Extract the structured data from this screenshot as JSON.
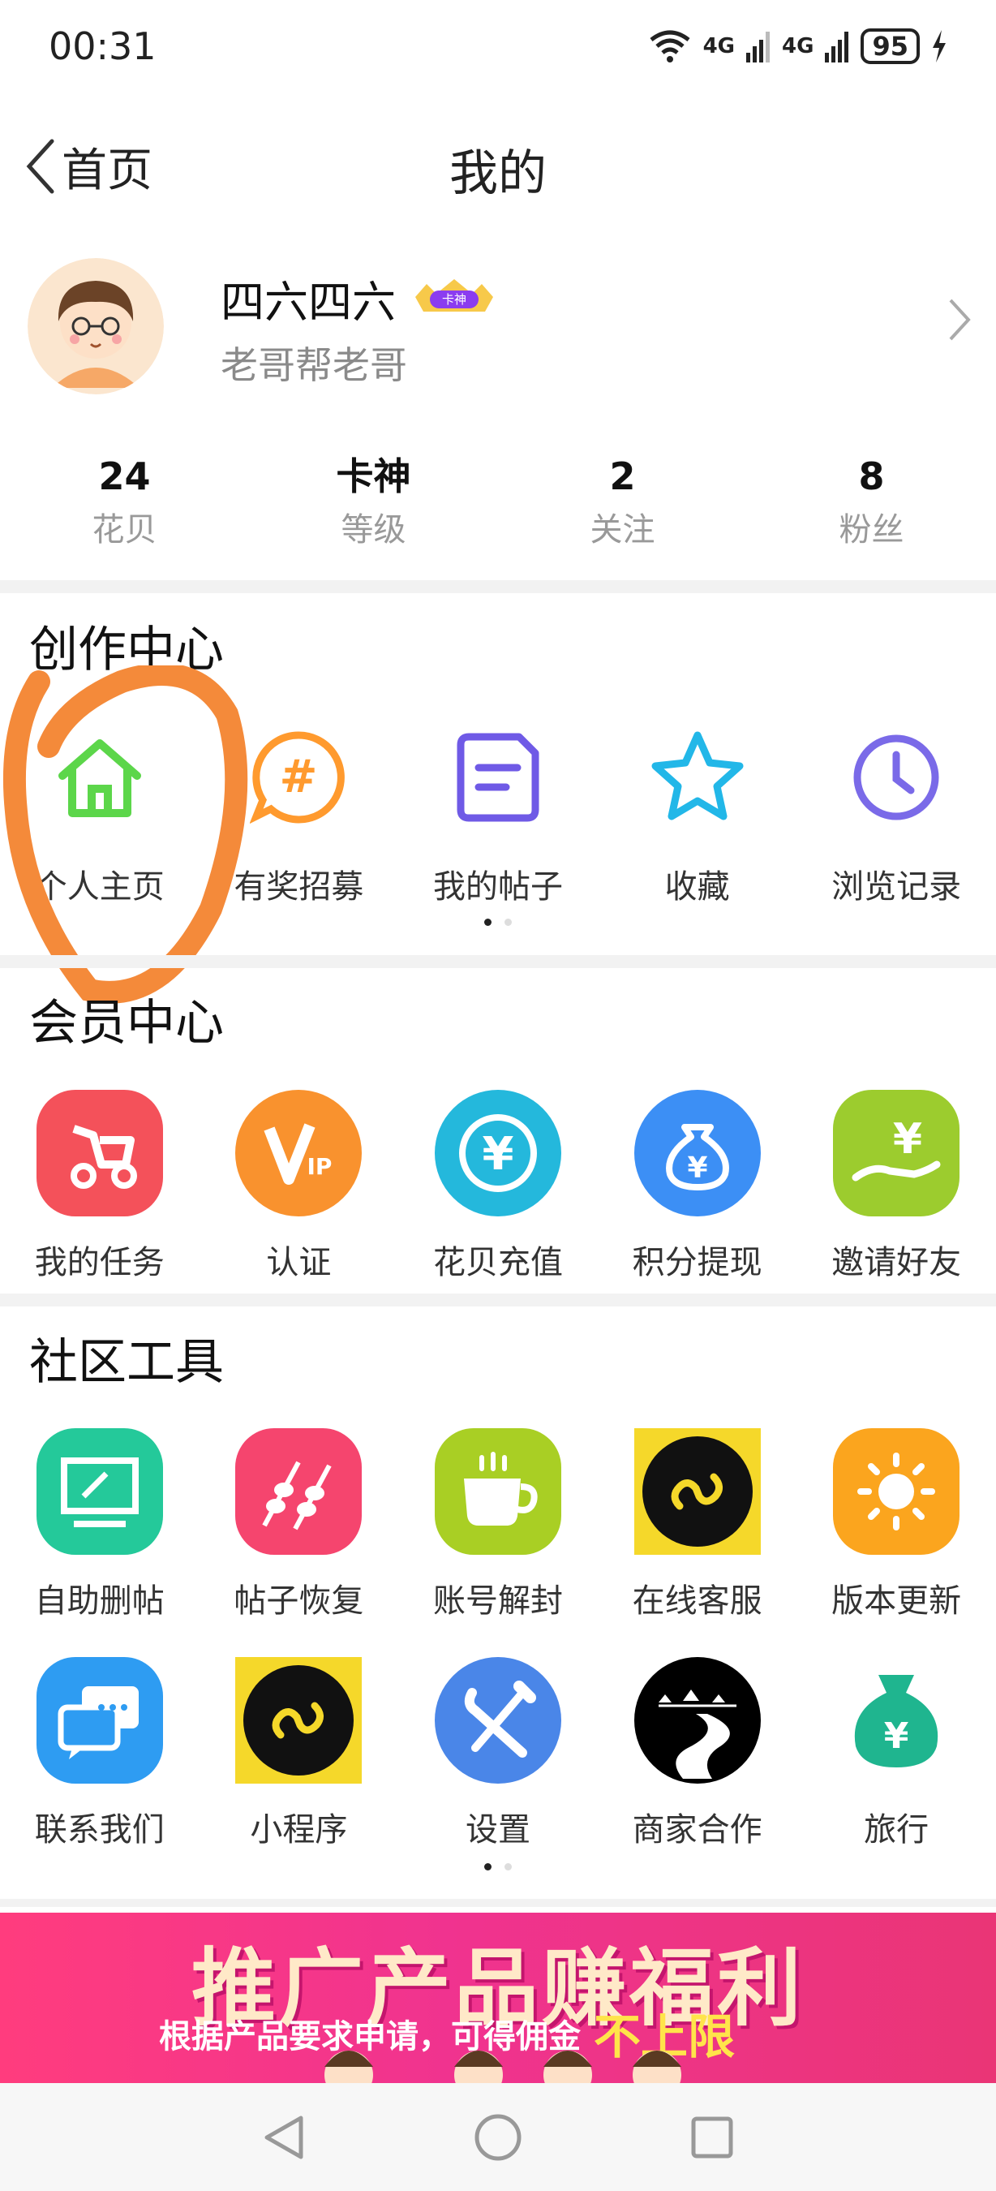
{
  "status_bar": {
    "time": "00:31",
    "battery": "95",
    "net1": "4G",
    "net2": "4G"
  },
  "header": {
    "back_label": "首页",
    "title": "我的"
  },
  "profile": {
    "nickname": "四六四六",
    "badge": "卡神",
    "signature": "老哥帮老哥"
  },
  "stats": [
    {
      "value": "24",
      "label": "花贝"
    },
    {
      "value": "卡神",
      "label": "等级"
    },
    {
      "value": "2",
      "label": "关注"
    },
    {
      "value": "8",
      "label": "粉丝"
    }
  ],
  "creation": {
    "title": "创作中心",
    "items": [
      {
        "label": "个人主页",
        "icon": "home-icon"
      },
      {
        "label": "有奖招募",
        "icon": "hashtag-icon"
      },
      {
        "label": "我的帖子",
        "icon": "document-icon"
      },
      {
        "label": "收藏",
        "icon": "star-icon"
      },
      {
        "label": "浏览记录",
        "icon": "clock-icon"
      }
    ]
  },
  "member": {
    "title": "会员中心",
    "items": [
      {
        "label": "我的任务",
        "icon": "scooter-icon",
        "color": "#f4515a"
      },
      {
        "label": "认证",
        "icon": "vip-icon",
        "color": "#f9922e"
      },
      {
        "label": "花贝充值",
        "icon": "coin-recharge-icon",
        "color": "#24b8dc"
      },
      {
        "label": "积分提现",
        "icon": "money-bag-icon",
        "color": "#3c8ff5"
      },
      {
        "label": "邀请好友",
        "icon": "hand-yuan-icon",
        "color": "#9ccc2e"
      }
    ]
  },
  "tools": {
    "title": "社区工具",
    "row1": [
      {
        "label": "自助删帖",
        "icon": "monitor-edit-icon",
        "color": "#24c99a"
      },
      {
        "label": "帖子恢复",
        "icon": "skewer-icon",
        "color": "#f5456e"
      },
      {
        "label": "账号解封",
        "icon": "coffee-cup-icon",
        "color": "#a9cf24"
      },
      {
        "label": "在线客服",
        "icon": "mini-program-icon",
        "color": "#f5d82a"
      },
      {
        "label": "版本更新",
        "icon": "sun-icon",
        "color": "#fba51e"
      }
    ],
    "row2": [
      {
        "label": "联系我们",
        "icon": "chat-icon",
        "color": "#2e9cf2"
      },
      {
        "label": "小程序",
        "icon": "mini-program-icon",
        "color": "#f5d82a"
      },
      {
        "label": "设置",
        "icon": "wrench-icon",
        "color": "#4a86e8"
      },
      {
        "label": "商家合作",
        "icon": "road-night-icon",
        "color": "#000000"
      },
      {
        "label": "旅行",
        "icon": "money-bag-icon",
        "color": "#1fb58f"
      }
    ]
  },
  "banner": {
    "title": "推广产品赚福利",
    "subtitle": "根据产品要求申请，可得佣金",
    "highlight": "不上限"
  },
  "colors": {
    "divider": "#f2f2f2",
    "annotation": "#f48a3a"
  }
}
